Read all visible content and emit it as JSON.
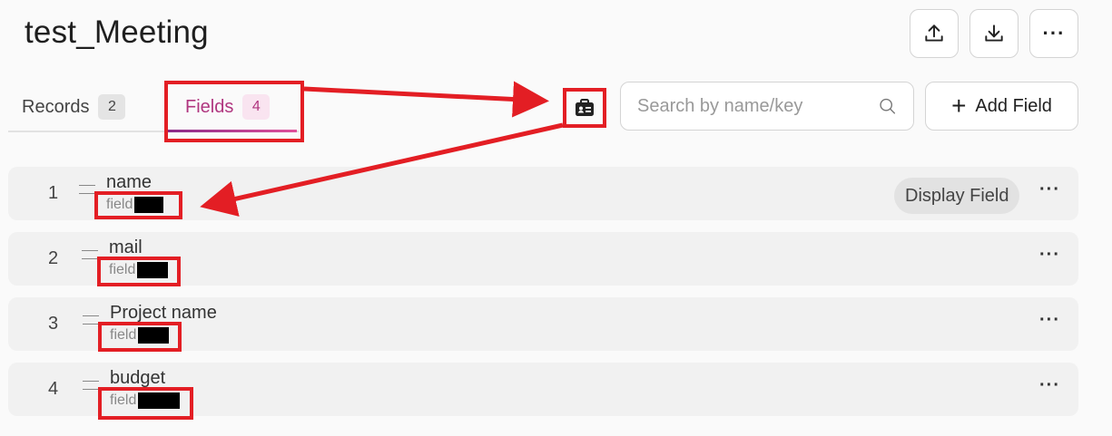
{
  "header": {
    "title": "test_Meeting",
    "upload_icon": "upload-icon",
    "download_icon": "download-icon",
    "more_label": "···"
  },
  "tabs": [
    {
      "label": "Records",
      "count": "2"
    },
    {
      "label": "Fields",
      "count": "4"
    }
  ],
  "toolbar": {
    "id_card_icon": "id-card-icon",
    "search_placeholder": "Search by name/key",
    "add_field_label": "Add Field"
  },
  "fields": [
    {
      "index": "1",
      "name": "name",
      "key_prefix": "field",
      "chip": "Display Field",
      "more": "···"
    },
    {
      "index": "2",
      "name": "mail",
      "key_prefix": "field",
      "more": "···"
    },
    {
      "index": "3",
      "name": "Project name",
      "key_prefix": "field",
      "more": "···"
    },
    {
      "index": "4",
      "name": "budget",
      "key_prefix": "field",
      "more": "···"
    }
  ],
  "colors": {
    "accent": "#b0357f",
    "annotation_red": "#e31e24"
  }
}
